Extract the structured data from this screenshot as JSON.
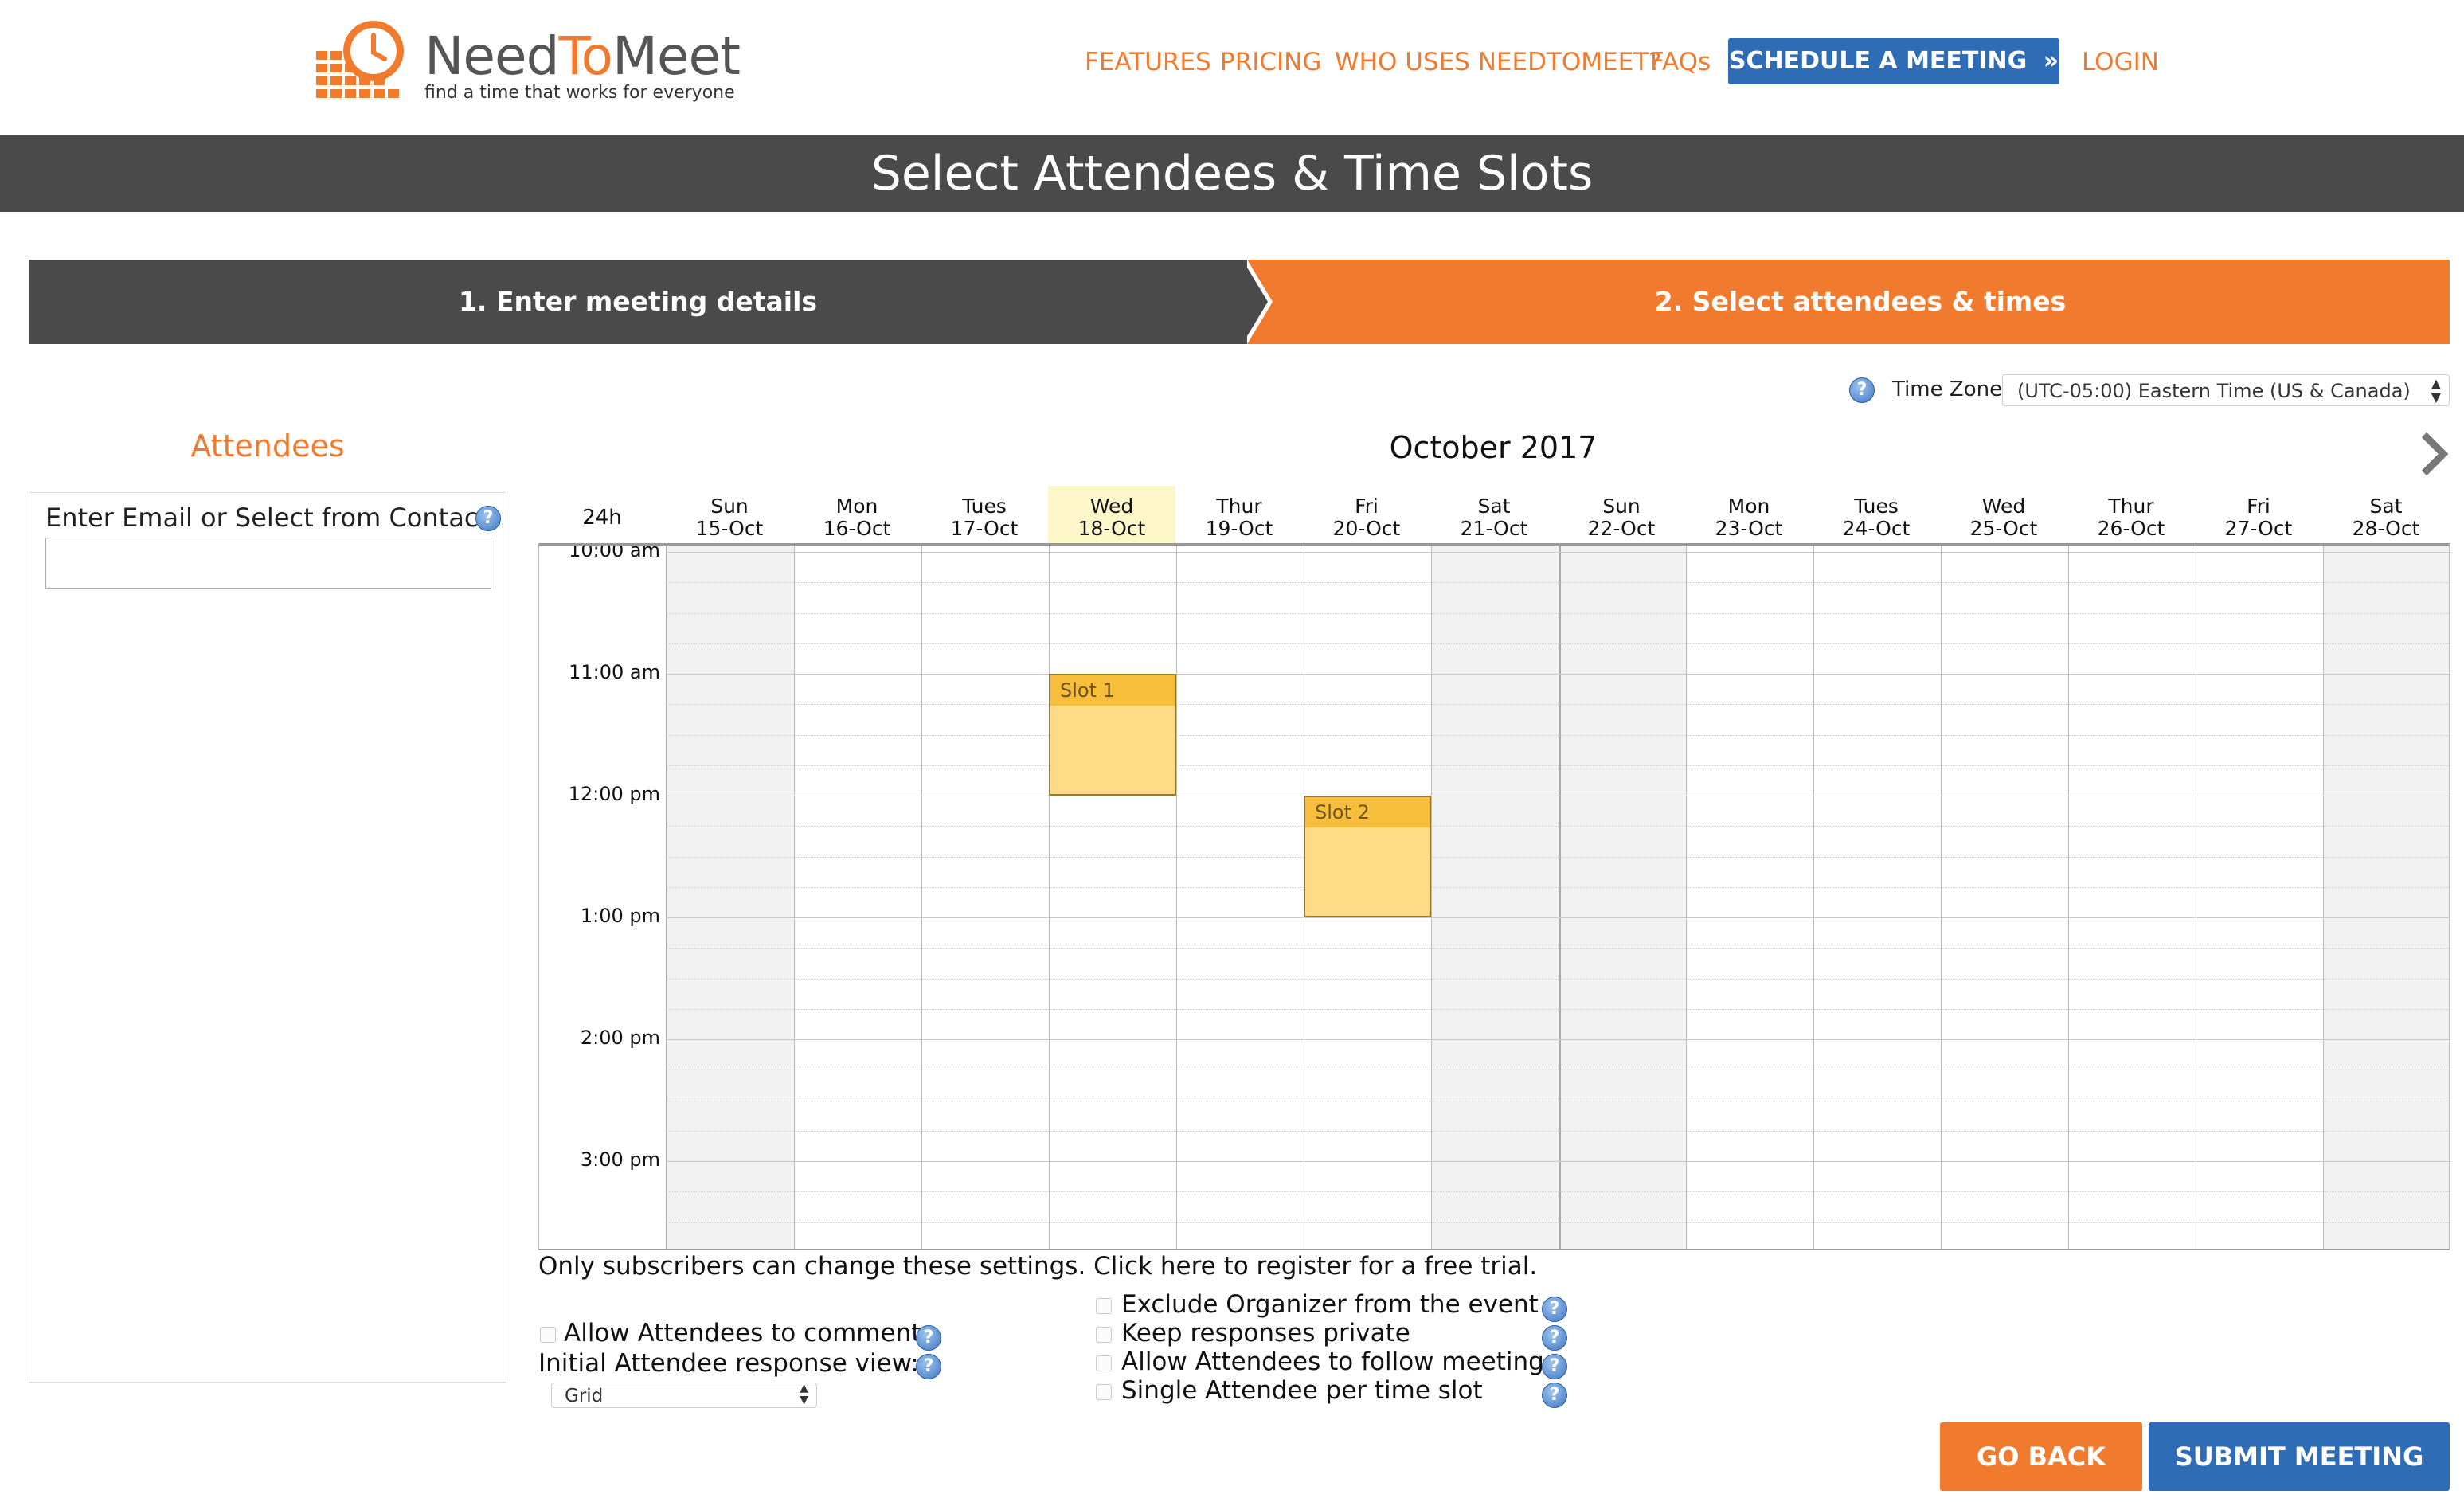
{
  "brand": {
    "name_need": "Need",
    "name_to": "To",
    "name_meet": "Meet",
    "tagline": "find a time that works for everyone",
    "accent_color": "#f07b2f",
    "primary_color": "#2e6db5"
  },
  "nav": {
    "features": "FEATURES",
    "pricing": "PRICING",
    "who_uses": "WHO USES NEEDTOMEET?",
    "faqs": "FAQs",
    "schedule": "SCHEDULE A MEETING",
    "schedule_icon": "double-chevron-right-icon",
    "login": "LOGIN"
  },
  "banner": {
    "title": "Select Attendees & Time Slots"
  },
  "steps": [
    {
      "label": "1. Enter meeting details",
      "active": false
    },
    {
      "label": "2. Select attendees & times",
      "active": true
    }
  ],
  "timezone": {
    "label": "Time Zone:",
    "value": "(UTC-05:00) Eastern Time (US & Canada)"
  },
  "attendees": {
    "title": "Attendees",
    "field_label": "Enter Email or Select from Contacts",
    "field_value": ""
  },
  "calendar": {
    "month": "October 2017",
    "format_label": "24h",
    "days": [
      {
        "dow": "Sun",
        "date": "15-Oct",
        "weekend": true,
        "today": false
      },
      {
        "dow": "Mon",
        "date": "16-Oct",
        "weekend": false,
        "today": false
      },
      {
        "dow": "Tues",
        "date": "17-Oct",
        "weekend": false,
        "today": false
      },
      {
        "dow": "Wed",
        "date": "18-Oct",
        "weekend": false,
        "today": true
      },
      {
        "dow": "Thur",
        "date": "19-Oct",
        "weekend": false,
        "today": false
      },
      {
        "dow": "Fri",
        "date": "20-Oct",
        "weekend": false,
        "today": false
      },
      {
        "dow": "Sat",
        "date": "21-Oct",
        "weekend": true,
        "today": false
      },
      {
        "dow": "Sun",
        "date": "22-Oct",
        "weekend": true,
        "today": false
      },
      {
        "dow": "Mon",
        "date": "23-Oct",
        "weekend": false,
        "today": false
      },
      {
        "dow": "Tues",
        "date": "24-Oct",
        "weekend": false,
        "today": false
      },
      {
        "dow": "Wed",
        "date": "25-Oct",
        "weekend": false,
        "today": false
      },
      {
        "dow": "Thur",
        "date": "26-Oct",
        "weekend": false,
        "today": false
      },
      {
        "dow": "Fri",
        "date": "27-Oct",
        "weekend": false,
        "today": false
      },
      {
        "dow": "Sat",
        "date": "28-Oct",
        "weekend": true,
        "today": false
      }
    ],
    "times": [
      "10:00 am",
      "11:00 am",
      "12:00 pm",
      "1:00 pm",
      "2:00 pm",
      "3:00 pm"
    ],
    "slots": [
      {
        "label": "Slot 1",
        "day": "18-Oct",
        "start": "11:00 am",
        "end": "12:00 pm"
      },
      {
        "label": "Slot 2",
        "day": "20-Oct",
        "start": "12:00 pm",
        "end": "1:00 pm"
      }
    ]
  },
  "settings": {
    "notice": "Only subscribers can change these settings. Click here to register for a free trial.",
    "allow_comment": "Allow Attendees to comment",
    "response_view_label": "Initial Attendee response view:",
    "response_view_value": "Grid",
    "exclude_organizer": "Exclude Organizer from the event",
    "keep_private": "Keep responses private",
    "allow_follow": "Allow Attendees to follow meetings",
    "single_attendee": "Single Attendee per time slot"
  },
  "actions": {
    "go_back": "GO BACK",
    "submit": "SUBMIT MEETING"
  }
}
